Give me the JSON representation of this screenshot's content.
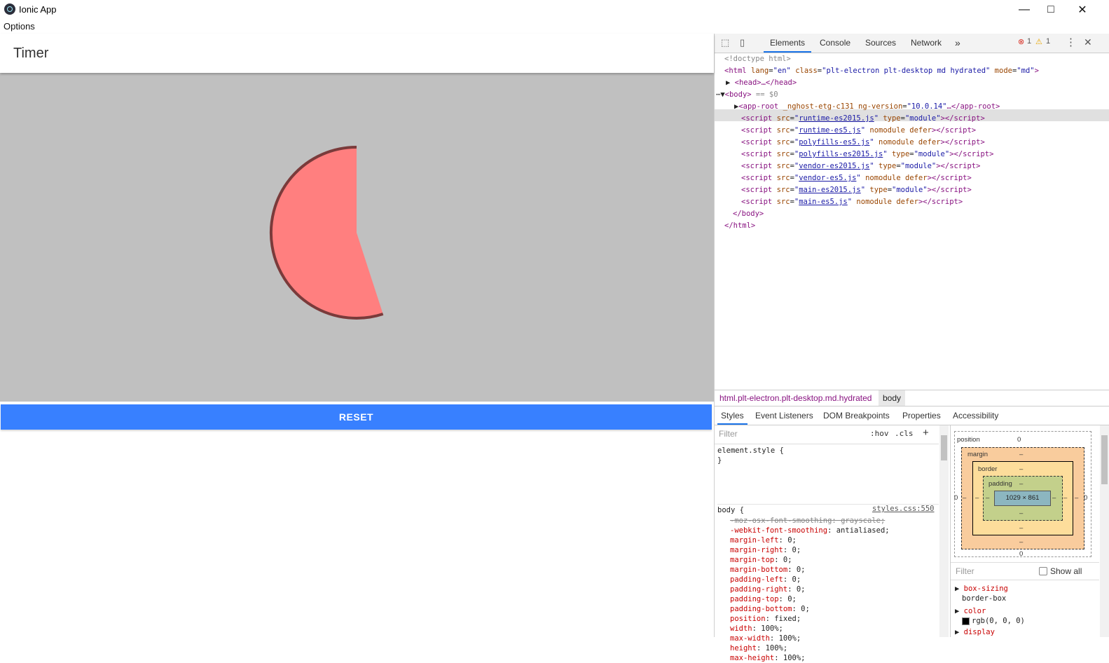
{
  "window": {
    "title": "Ionic App",
    "menu": [
      "Options"
    ],
    "controls": [
      "minimize-icon",
      "maximize-icon",
      "close-icon"
    ]
  },
  "app": {
    "toolbar_title": "Timer",
    "reset_label": "RESET",
    "colors": {
      "content_bg": "#c0c0c0",
      "pie_fill": "#ff7f7f",
      "pie_stroke": "#7a3b3b",
      "button": "#3880ff"
    },
    "timer": {
      "remaining_fraction": 0.55
    }
  },
  "devtools": {
    "tabs": [
      "Elements",
      "Console",
      "Sources",
      "Network"
    ],
    "more_tabs_icon": "chevron-double-right-icon",
    "errors": "1",
    "warnings": "1",
    "dom": {
      "doctype": "<!doctype html>",
      "html_open": {
        "tag": "<html",
        "attrs": [
          [
            "lang",
            "\"en\""
          ],
          [
            "class",
            "\"plt-electron plt-desktop md hydrated\""
          ],
          [
            "mode",
            "\"md\""
          ]
        ]
      },
      "head": "<head>…</head>",
      "body_open": "<body>",
      "body_marker": "== $0",
      "app_root": {
        "tag": "<app-root",
        "attr_name": "_nghost-etg-c131",
        "attr2_name": "ng-version",
        "attr2_value": "\"10.0.14\"",
        "tail": "…</app-root>"
      },
      "scripts": [
        {
          "src": "runtime-es2015.js",
          "rest_name": "type",
          "rest_value": "\"module\""
        },
        {
          "src": "runtime-es5.js",
          "rest_name": "nomodule defer",
          "rest_value": ""
        },
        {
          "src": "polyfills-es5.js",
          "rest_name": "nomodule defer",
          "rest_value": ""
        },
        {
          "src": "polyfills-es2015.js",
          "rest_name": "type",
          "rest_value": "\"module\""
        },
        {
          "src": "vendor-es2015.js",
          "rest_name": "type",
          "rest_value": "\"module\""
        },
        {
          "src": "vendor-es5.js",
          "rest_name": "nomodule defer",
          "rest_value": ""
        },
        {
          "src": "main-es2015.js",
          "rest_name": "type",
          "rest_value": "\"module\""
        },
        {
          "src": "main-es5.js",
          "rest_name": "nomodule defer",
          "rest_value": ""
        }
      ],
      "body_close": "</body>",
      "html_close": "</html>"
    },
    "breadcrumbs": [
      "html.plt-electron.plt-desktop.md.hydrated",
      "body"
    ],
    "subtabs": [
      "Styles",
      "Event Listeners",
      "DOM Breakpoints",
      "Properties",
      "Accessibility"
    ],
    "styles": {
      "filter_placeholder": "Filter",
      "hov": ":hov",
      "cls": ".cls",
      "plus": "+",
      "element_style_open": "element.style {",
      "element_style_close": "}",
      "body_selector": "body {",
      "source_link": "styles.css:550",
      "props": [
        {
          "name": "-moz-osx-font-smoothing",
          "value": "grayscale;",
          "struck": true
        },
        {
          "name": "-webkit-font-smoothing",
          "value": "antialiased;",
          "struck": false
        },
        {
          "name": "margin-left",
          "value": "0;",
          "struck": false
        },
        {
          "name": "margin-right",
          "value": "0;",
          "struck": false
        },
        {
          "name": "margin-top",
          "value": "0;",
          "struck": false
        },
        {
          "name": "margin-bottom",
          "value": "0;",
          "struck": false
        },
        {
          "name": "padding-left",
          "value": "0;",
          "struck": false
        },
        {
          "name": "padding-right",
          "value": "0;",
          "struck": false
        },
        {
          "name": "padding-top",
          "value": "0;",
          "struck": false
        },
        {
          "name": "padding-bottom",
          "value": "0;",
          "struck": false
        },
        {
          "name": "position",
          "value": "fixed;",
          "struck": false
        },
        {
          "name": "width",
          "value": "100%;",
          "struck": false
        },
        {
          "name": "max-width",
          "value": "100%;",
          "struck": false
        },
        {
          "name": "height",
          "value": "100%;",
          "struck": false
        },
        {
          "name": "max-height",
          "value": "100%;",
          "struck": false
        }
      ]
    },
    "boxmodel": {
      "position_label": "position",
      "position_value": "0",
      "margin_label": "margin",
      "border_label": "border",
      "padding_label": "padding",
      "dash": "–",
      "content_size": "1029 × 861",
      "side_left": "0",
      "side_right": "0",
      "bottom_value": "0"
    },
    "computed": {
      "filter_placeholder": "Filter",
      "show_all": "Show all",
      "props": [
        {
          "name": "box-sizing",
          "value": "border-box"
        },
        {
          "name": "color",
          "value": "rgb(0, 0, 0)"
        },
        {
          "name": "display",
          "value": ""
        }
      ]
    }
  }
}
